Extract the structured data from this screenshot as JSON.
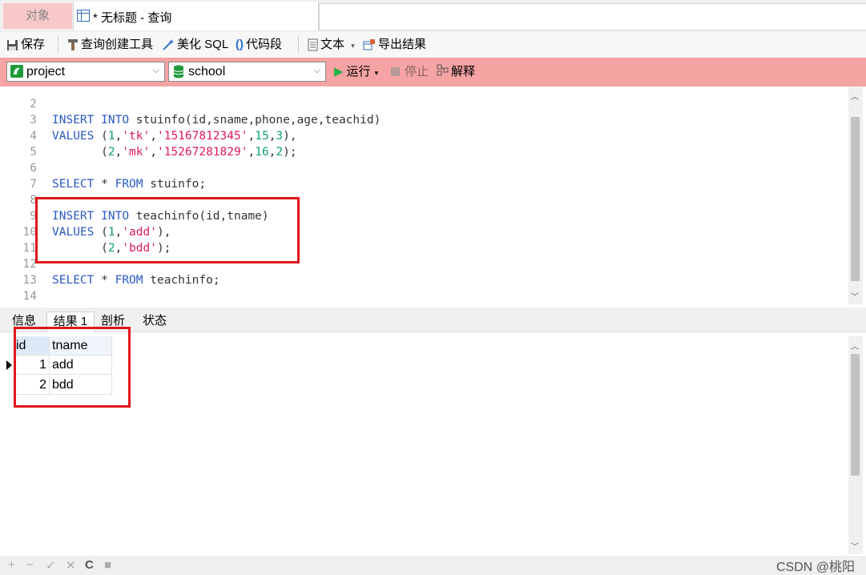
{
  "tabs": {
    "objects": "对象",
    "query": "* 无标题 - 查询"
  },
  "toolbar": {
    "save": "保存",
    "query_builder": "查询创建工具",
    "beautify_sql": "美化 SQL",
    "code_snippet": "代码段",
    "text": "文本",
    "export": "导出结果"
  },
  "connection": {
    "connection_name": "project",
    "database": "school",
    "run": "运行",
    "stop": "停止",
    "explain": "解释"
  },
  "editor": {
    "lines": [
      {
        "n": "2",
        "tokens": []
      },
      {
        "n": "3",
        "tokens": [
          {
            "t": "INSERT",
            "c": "kw"
          },
          {
            "t": " ",
            "c": "plain"
          },
          {
            "t": "INTO",
            "c": "kw"
          },
          {
            "t": " stuinfo(id,sname,phone,age,teachid)",
            "c": "plain"
          }
        ]
      },
      {
        "n": "4",
        "tokens": [
          {
            "t": "VALUES",
            "c": "kw"
          },
          {
            "t": " (",
            "c": "plain"
          },
          {
            "t": "1",
            "c": "num"
          },
          {
            "t": ",",
            "c": "plain"
          },
          {
            "t": "'tk'",
            "c": "str"
          },
          {
            "t": ",",
            "c": "plain"
          },
          {
            "t": "'15167812345'",
            "c": "str"
          },
          {
            "t": ",",
            "c": "plain"
          },
          {
            "t": "15",
            "c": "num"
          },
          {
            "t": ",",
            "c": "plain"
          },
          {
            "t": "3",
            "c": "num"
          },
          {
            "t": "),",
            "c": "plain"
          }
        ]
      },
      {
        "n": "5",
        "tokens": [
          {
            "t": "       (",
            "c": "plain"
          },
          {
            "t": "2",
            "c": "num"
          },
          {
            "t": ",",
            "c": "plain"
          },
          {
            "t": "'mk'",
            "c": "str"
          },
          {
            "t": ",",
            "c": "plain"
          },
          {
            "t": "'15267281829'",
            "c": "str"
          },
          {
            "t": ",",
            "c": "plain"
          },
          {
            "t": "16",
            "c": "num"
          },
          {
            "t": ",",
            "c": "plain"
          },
          {
            "t": "2",
            "c": "num"
          },
          {
            "t": ");",
            "c": "plain"
          }
        ]
      },
      {
        "n": "6",
        "tokens": []
      },
      {
        "n": "7",
        "tokens": [
          {
            "t": "SELECT",
            "c": "kw"
          },
          {
            "t": " * ",
            "c": "plain"
          },
          {
            "t": "FROM",
            "c": "kw"
          },
          {
            "t": " stuinfo;",
            "c": "plain"
          }
        ]
      },
      {
        "n": "8",
        "tokens": []
      },
      {
        "n": "9",
        "tokens": [
          {
            "t": "INSERT",
            "c": "kw"
          },
          {
            "t": " ",
            "c": "plain"
          },
          {
            "t": "INTO",
            "c": "kw"
          },
          {
            "t": " teachinfo(id,tname)",
            "c": "plain"
          }
        ]
      },
      {
        "n": "10",
        "tokens": [
          {
            "t": "VALUES",
            "c": "kw"
          },
          {
            "t": " (",
            "c": "plain"
          },
          {
            "t": "1",
            "c": "num"
          },
          {
            "t": ",",
            "c": "plain"
          },
          {
            "t": "'add'",
            "c": "str"
          },
          {
            "t": "),",
            "c": "plain"
          }
        ]
      },
      {
        "n": "11",
        "tokens": [
          {
            "t": "       (",
            "c": "plain"
          },
          {
            "t": "2",
            "c": "num"
          },
          {
            "t": ",",
            "c": "plain"
          },
          {
            "t": "'bdd'",
            "c": "str"
          },
          {
            "t": ");",
            "c": "plain"
          }
        ]
      },
      {
        "n": "12",
        "tokens": []
      },
      {
        "n": "13",
        "tokens": [
          {
            "t": "SELECT",
            "c": "kw"
          },
          {
            "t": " * ",
            "c": "plain"
          },
          {
            "t": "FROM",
            "c": "kw"
          },
          {
            "t": " teachinfo;",
            "c": "plain"
          }
        ]
      },
      {
        "n": "14",
        "tokens": []
      }
    ]
  },
  "result_tabs": [
    "信息",
    "结果 1",
    "剖析",
    "状态"
  ],
  "result": {
    "columns": [
      "id",
      "tname"
    ],
    "rows": [
      [
        "1",
        "add"
      ],
      [
        "2",
        "bdd"
      ]
    ]
  },
  "status": {
    "icons": [
      "+",
      "−",
      "✓",
      "✕",
      "C",
      "■"
    ],
    "watermark": "CSDN @桃阳"
  },
  "colors": {
    "connbar": "#f6a3a3",
    "highlight_box": "#e0151c",
    "keyword": "#2b59c3",
    "string": "#e0185f",
    "number": "#13a06a"
  }
}
